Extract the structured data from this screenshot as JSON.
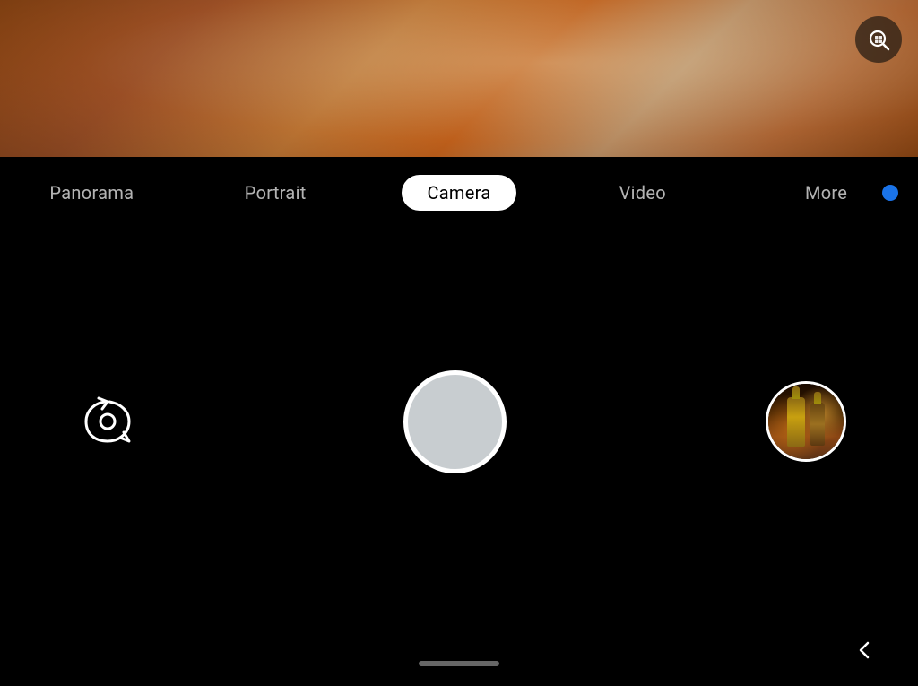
{
  "viewfinder": {
    "alt": "Camera viewfinder showing blurred scene"
  },
  "lens_button": {
    "icon": "google-lens-icon",
    "aria": "Google Lens search"
  },
  "mode_bar": {
    "modes": [
      {
        "id": "panorama",
        "label": "Panorama",
        "active": false
      },
      {
        "id": "portrait",
        "label": "Portrait",
        "active": false
      },
      {
        "id": "camera",
        "label": "Camera",
        "active": true
      },
      {
        "id": "video",
        "label": "Video",
        "active": false
      },
      {
        "id": "more",
        "label": "More",
        "active": false
      }
    ]
  },
  "controls": {
    "flip_label": "Flip camera",
    "shutter_label": "Take photo",
    "gallery_label": "Gallery"
  },
  "bottom_bar": {
    "back_label": "Back",
    "home_indicator": "Home"
  }
}
